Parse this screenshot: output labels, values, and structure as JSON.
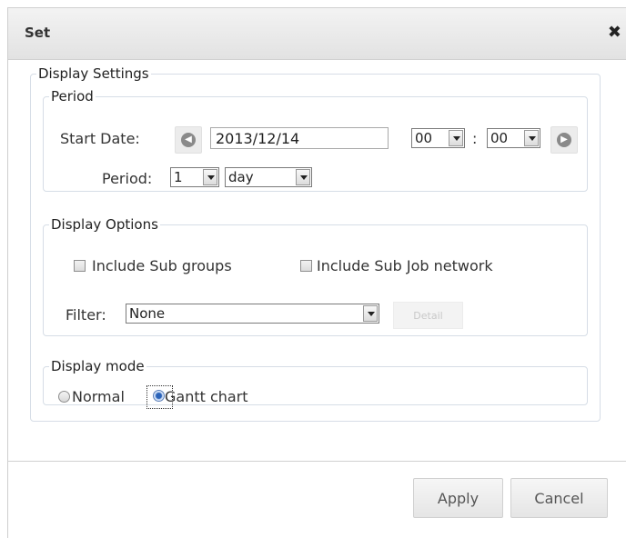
{
  "dialog": {
    "title": "Set",
    "close_glyph": "✖"
  },
  "display_settings": {
    "legend": "Display Settings",
    "period": {
      "legend": "Period",
      "start_date_label": "Start Date:",
      "start_date_value": "2013/12/14",
      "hour": "00",
      "time_separator": ":",
      "minute": "00",
      "period_label": "Period:",
      "period_count": "1",
      "period_unit": "day",
      "prev_icon": "arrow-left-circle-icon",
      "next_icon": "arrow-right-circle-icon"
    },
    "options": {
      "legend": "Display Options",
      "include_sub_groups_label": "Include Sub groups",
      "include_sub_groups_checked": false,
      "include_sub_job_network_label": "Include Sub Job network",
      "include_sub_job_network_checked": false,
      "filter_label": "Filter:",
      "filter_value": "None",
      "detail_label": "Detail"
    },
    "mode": {
      "legend": "Display mode",
      "normal_label": "Normal",
      "gantt_label": "Gantt chart",
      "selected": "Gantt chart"
    }
  },
  "footer": {
    "apply_label": "Apply",
    "cancel_label": "Cancel"
  }
}
